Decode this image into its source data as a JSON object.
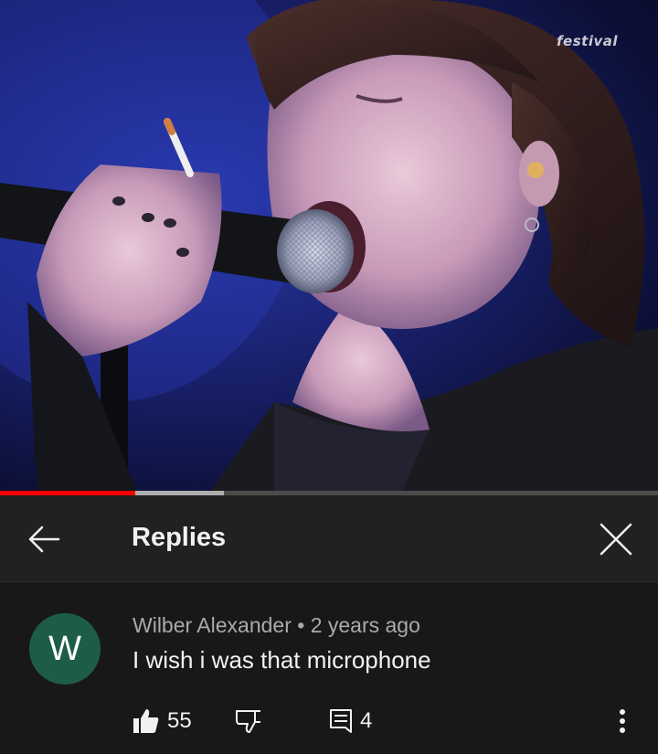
{
  "video": {
    "watermark": "festival",
    "progress_played": 0.205,
    "progress_buffered": 0.34
  },
  "header": {
    "title": "Replies",
    "back_icon": "arrow-left-icon",
    "close_icon": "close-icon"
  },
  "comment": {
    "avatar_letter": "W",
    "avatar_color": "#1e5c4a",
    "author": "Wilber Alexander",
    "separator": "•",
    "age": "2 years ago",
    "text": "I wish i was that microphone",
    "likes": "55",
    "replies": "4"
  },
  "colors": {
    "background": "#181818",
    "header": "#212121",
    "accent": "#ff0000"
  }
}
